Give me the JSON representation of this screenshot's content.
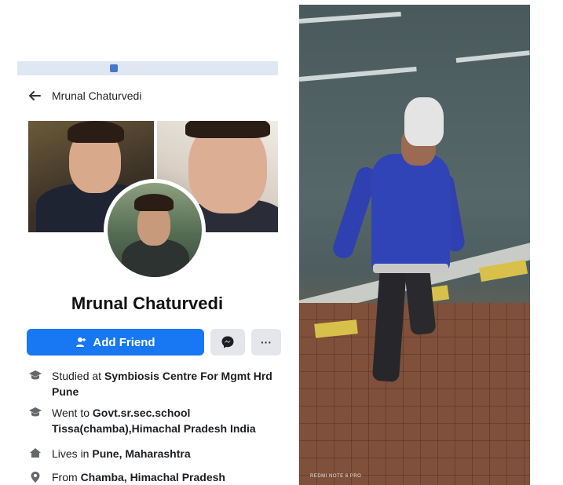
{
  "left_panel": {
    "header_name": "Mrunal Chaturvedi",
    "profile_name": "Mrunal Chaturvedi",
    "add_friend_label": "Add Friend",
    "more_label": "···",
    "info": [
      {
        "icon": "graduation-cap-icon",
        "prefix": "Studied at ",
        "bold": "Symbiosis Centre For Mgmt Hrd Pune"
      },
      {
        "icon": "graduation-cap-icon",
        "prefix": "Went to ",
        "bold": "Govt.sr.sec.school Tissa(chamba),Himachal Pradesh India"
      },
      {
        "icon": "home-icon",
        "prefix": "Lives in ",
        "bold": "Pune, Maharashtra"
      },
      {
        "icon": "location-pin-icon",
        "prefix": "From ",
        "bold": "Chamba, Himachal Pradesh"
      }
    ],
    "colors": {
      "accent": "#1877f2",
      "button_gray": "#e4e6eb"
    }
  },
  "right_panel": {
    "camera_label": "REDMI NOTE 6 PRO"
  }
}
